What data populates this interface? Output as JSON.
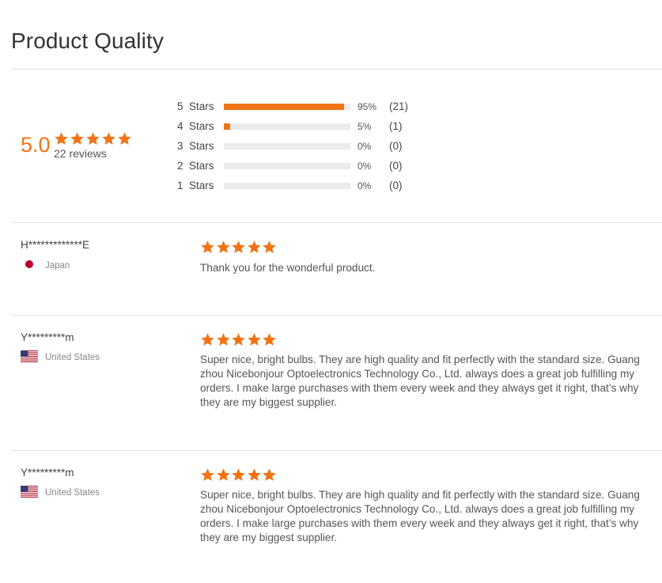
{
  "title": "Product Quality",
  "summary": {
    "score": "5.0",
    "stars": 5,
    "count_text": "22 reviews"
  },
  "distribution": [
    {
      "label": "5  Stars",
      "fraction": 0.95,
      "pct": "95%",
      "count": "(21)"
    },
    {
      "label": "4  Stars",
      "fraction": 0.05,
      "pct": "5%",
      "count": "(1)"
    },
    {
      "label": "3  Stars",
      "fraction": 0.0,
      "pct": "0%",
      "count": "(0)"
    },
    {
      "label": "2  Stars",
      "fraction": 0.0,
      "pct": "0%",
      "count": "(0)"
    },
    {
      "label": "1  Stars",
      "fraction": 0.0,
      "pct": "0%",
      "count": "(0)"
    }
  ],
  "reviews": [
    {
      "name": "H*************E",
      "country": "Japan",
      "flag_icon": "japan-flag-icon",
      "stars": 5,
      "text": "Thank you for the wonderful product."
    },
    {
      "name": "Y*********m",
      "country": "United States",
      "flag_icon": "us-flag-icon",
      "stars": 5,
      "text": "Super nice, bright bulbs. They are high quality and fit perfectly with the standard size. Guang zhou Nicebonjour Optoelectronics Technology Co., Ltd. always does a great job fulfilling my orders. I make large purchases with them every week and they always get it right, that’s why they are my biggest supplier."
    },
    {
      "name": "Y*********m",
      "country": "United States",
      "flag_icon": "us-flag-icon",
      "stars": 5,
      "text": "Super nice, bright bulbs. They are high quality and fit perfectly with the standard size. Guang zhou Nicebonjour Optoelectronics Technology Co., Ltd. always does a great job fulfilling my orders. I make large purchases with them every week and they always get it right, that’s why they are my biggest supplier."
    }
  ],
  "colors": {
    "accent": "#f07416",
    "track": "#ebebeb",
    "divider": "#e3e3e3",
    "japan_red": "#bc002d",
    "us_red": "#b22234",
    "us_blue": "#3c3b6e"
  }
}
